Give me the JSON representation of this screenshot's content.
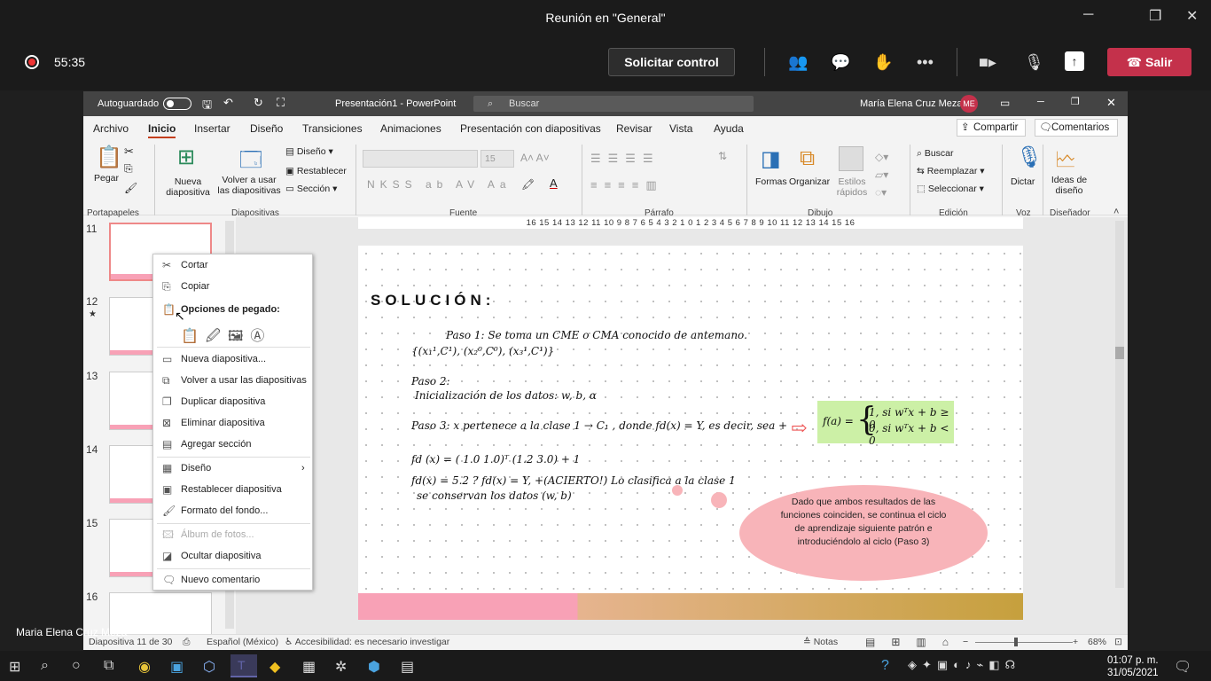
{
  "teams": {
    "title": "Reunión en \"General\"",
    "timer": "55:35",
    "request_control": "Solicitar control",
    "leave": "Salir"
  },
  "ppt": {
    "autosave": "Autoguardado",
    "doc_title": "Presentación1 - PowerPoint",
    "search_placeholder": "Buscar",
    "user_name": "María Elena Cruz Meza",
    "user_initials": "ME",
    "menu": [
      "Archivo",
      "Inicio",
      "Insertar",
      "Diseño",
      "Transiciones",
      "Animaciones",
      "Presentación con diapositivas",
      "Revisar",
      "Vista",
      "Ayuda"
    ],
    "share": "Compartir",
    "comments": "Comentarios",
    "ribbon": {
      "paste": "Pegar",
      "new_slide": "Nueva diapositiva",
      "reuse": "Volver a usar las diapositivas",
      "layout": "Diseño",
      "reset": "Restablecer",
      "section": "Sección",
      "font_size": "15",
      "shapes": "Formas",
      "arrange": "Organizar",
      "quick_styles": "Estilos rápidos",
      "find": "Buscar",
      "replace": "Reemplazar",
      "select": "Seleccionar",
      "dictate": "Dictar",
      "designer": "Ideas de diseño",
      "groups": [
        "Portapapeles",
        "Diapositivas",
        "Fuente",
        "Párrafo",
        "Dibujo",
        "Edición",
        "Voz",
        "Diseñador"
      ]
    },
    "ruler": "16 15 14 13 12 11 10 9 8 7 6 5 4 3 2 1 0 1 2 3 4 5 6 7 8 9 10 11 12 13 14 15 16",
    "thumb_numbers": [
      "11",
      "12",
      "13",
      "14",
      "15",
      "16"
    ],
    "slide": {
      "title": "SOLUCIÓN:",
      "paso1": "Paso 1: Se toma un CME o CMA conocido de antemano.",
      "paso1_set": "{(x₁¹,C¹), (x₂⁰,C⁰), (x₃¹,C¹)}",
      "paso2": "Paso 2:",
      "paso2_text": "Inicialización de los datos: w, b, α",
      "paso3": "Paso 3: x pertenece a la clase 1 → C₁ , donde fd(x) = Y, es decir, sea +",
      "fd_line": "fd (x) = ( 1.0    1.0)ᵀ (1.2 3.0) + 1",
      "fd_result": "fd(x) = 5.2  ?  fd(x) = Y,  +(ACIERTO!)  Lo clasifica a la clase 1",
      "conserve": "se conservan los datos (w, b)",
      "formula_lhs": "f(a) =",
      "formula_1": "1, si wᵀx + b ≥ 0",
      "formula_0": "0, si wᵀx + b < 0",
      "cloud_text": "Dado que ambos resultados de las funciones coinciden, se continua el ciclo de aprendizaje siguiente patrón e introduciéndolo al ciclo (Paso 3)"
    },
    "context_menu": {
      "cut": "Cortar",
      "copy": "Copiar",
      "paste_options": "Opciones de pegado:",
      "new_slide": "Nueva diapositiva...",
      "reuse": "Volver a usar las diapositivas",
      "duplicate": "Duplicar diapositiva",
      "delete": "Eliminar diapositiva",
      "add_section": "Agregar sección",
      "layout": "Diseño",
      "reset": "Restablecer diapositiva",
      "background": "Formato del fondo...",
      "album": "Álbum de fotos...",
      "hide": "Ocultar diapositiva",
      "new_comment": "Nuevo comentario"
    },
    "status": {
      "slide": "Diapositiva 11 de 30",
      "lang": "Español (México)",
      "access": "Accesibilidad: es necesario investigar",
      "notes": "Notas",
      "zoom": "68%"
    }
  },
  "caption": "Maria Elena Cruz Meza",
  "clock": {
    "time": "01:07 p. m.",
    "date": "31/05/2021"
  }
}
